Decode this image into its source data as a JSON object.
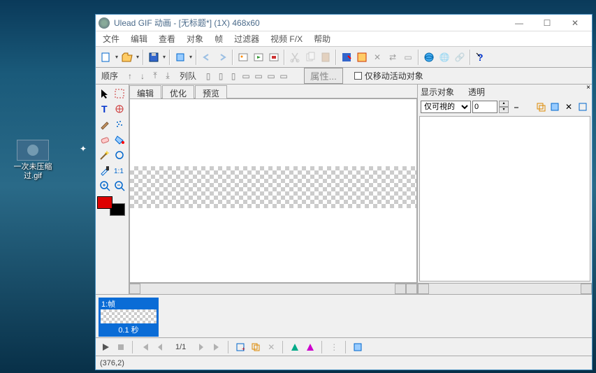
{
  "desktop": {
    "icon_label": "一次未压缩过.gif"
  },
  "window": {
    "title": "Ulead GIF 动画 - [无标题*] (1X) 468x60"
  },
  "menu": {
    "file": "文件",
    "edit": "编辑",
    "view": "查看",
    "object": "对象",
    "frame": "帧",
    "filter": "过滤器",
    "video": "视频 F/X",
    "help": "帮助"
  },
  "subbar": {
    "order": "顺序",
    "queue": "列队",
    "props": "属性...",
    "move_only": "仅移动活动对象"
  },
  "tabs": {
    "edit": "编辑",
    "optimize": "优化",
    "preview": "预览"
  },
  "rightpanel": {
    "show": "显示对象",
    "trans": "透明",
    "visible_only": "仅可視的",
    "zero": "0"
  },
  "frame": {
    "label": "1:帧",
    "duration": "0.1 秒"
  },
  "play": {
    "count": "1/1"
  },
  "status": {
    "coords": "(376,2)"
  }
}
